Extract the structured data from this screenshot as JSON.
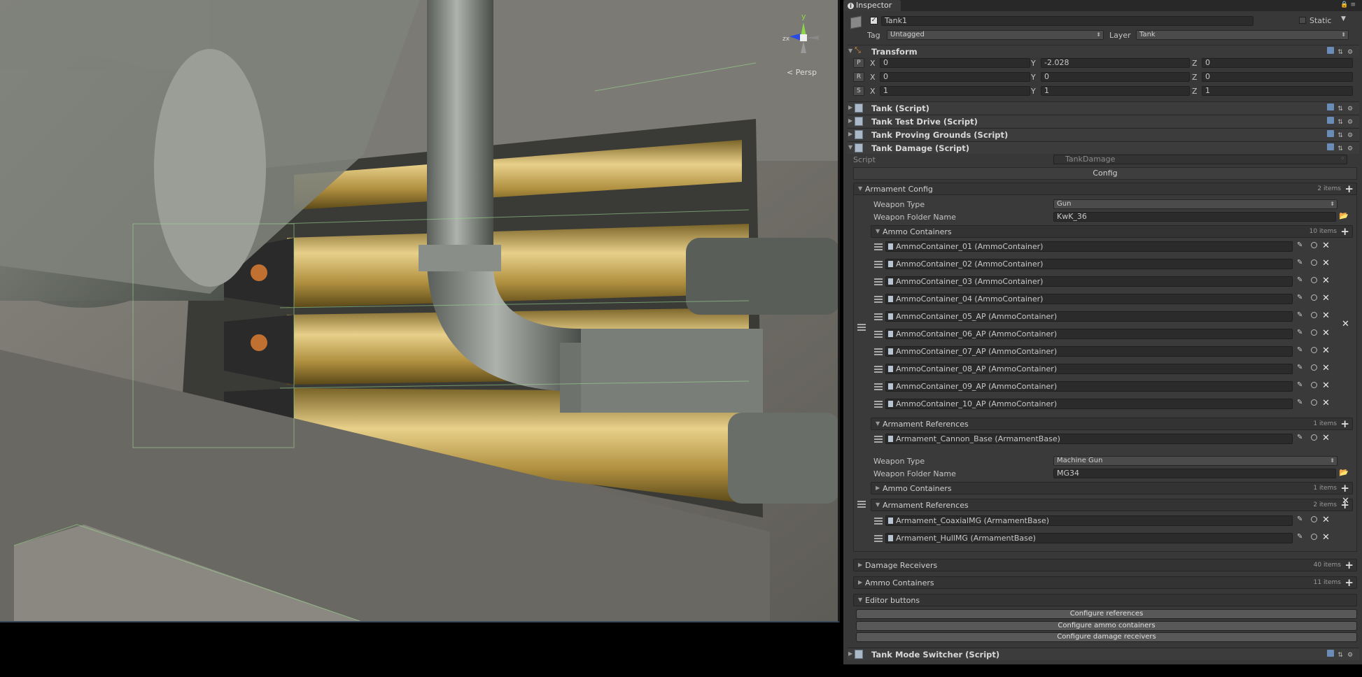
{
  "scene": {
    "view_label": "< Persp",
    "gizmo": {
      "y": "y",
      "z": "z",
      "x": "x"
    }
  },
  "inspector": {
    "tab_label": "Inspector",
    "object_name": "Tank1",
    "static_label": "Static",
    "tag_label": "Tag",
    "tag_value": "Untagged",
    "layer_label": "Layer",
    "layer_value": "Tank",
    "transform": {
      "title": "Transform",
      "position": {
        "btn": "P",
        "x": "0",
        "y": "-2.028",
        "z": "0"
      },
      "rotation": {
        "btn": "R",
        "x": "0",
        "y": "0",
        "z": "0"
      },
      "scale": {
        "btn": "S",
        "x": "1",
        "y": "1",
        "z": "1"
      },
      "x_label": "X",
      "y_label": "Y",
      "z_label": "Z"
    },
    "components": [
      "Tank (Script)",
      "Tank Test Drive (Script)",
      "Tank Proving Grounds (Script)",
      "Tank Damage (Script)"
    ],
    "script_label": "Script",
    "script_value": "TankDamage",
    "config_header": "Config",
    "armament_config": {
      "title": "Armament Config",
      "count": "2 items",
      "weapon1": {
        "type_label": "Weapon Type",
        "type_value": "Gun",
        "folder_label": "Weapon Folder Name",
        "folder_value": "KwK_36",
        "ammo": {
          "title": "Ammo Containers",
          "count": "10 items",
          "items": [
            "AmmoContainer_01 (AmmoContainer)",
            "AmmoContainer_02 (AmmoContainer)",
            "AmmoContainer_03 (AmmoContainer)",
            "AmmoContainer_04 (AmmoContainer)",
            "AmmoContainer_05_AP (AmmoContainer)",
            "AmmoContainer_06_AP (AmmoContainer)",
            "AmmoContainer_07_AP (AmmoContainer)",
            "AmmoContainer_08_AP (AmmoContainer)",
            "AmmoContainer_09_AP (AmmoContainer)",
            "AmmoContainer_10_AP (AmmoContainer)"
          ]
        },
        "refs": {
          "title": "Armament References",
          "count": "1 items",
          "items": [
            "Armament_Cannon_Base (ArmamentBase)"
          ]
        }
      },
      "weapon2": {
        "type_label": "Weapon Type",
        "type_value": "Machine Gun",
        "folder_label": "Weapon Folder Name",
        "folder_value": "MG34",
        "ammo": {
          "title": "Ammo Containers",
          "count": "1 items"
        },
        "refs": {
          "title": "Armament References",
          "count": "2 items",
          "items": [
            "Armament_CoaxialMG (ArmamentBase)",
            "Armament_HullMG (ArmamentBase)"
          ]
        }
      }
    },
    "damage_receivers": {
      "title": "Damage Receivers",
      "count": "40 items"
    },
    "ammo_containers": {
      "title": "Ammo Containers",
      "count": "11 items"
    },
    "editor_buttons": {
      "title": "Editor buttons",
      "buttons": [
        "Configure references",
        "Configure ammo containers",
        "Configure damage receivers"
      ]
    },
    "last_component": "Tank Mode Switcher (Script)"
  }
}
